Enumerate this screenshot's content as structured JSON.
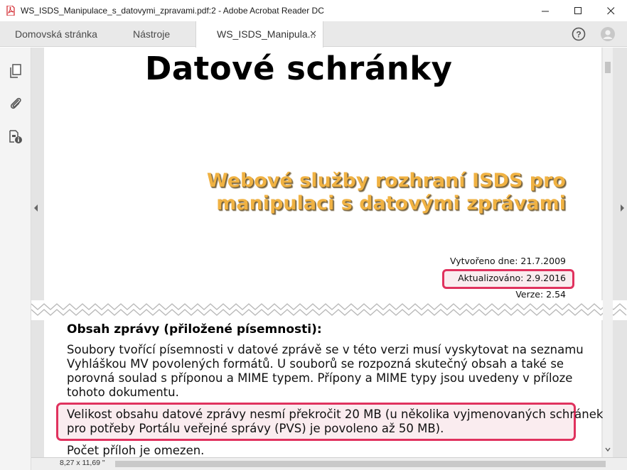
{
  "window": {
    "title": "WS_ISDS_Manipulace_s_datovymi_zpravami.pdf:2 - Adobe Acrobat Reader DC",
    "minimize_label": "—",
    "maximize_label": "☐",
    "close_label": "✕"
  },
  "tabs": [
    {
      "label": "Domovská stránka"
    },
    {
      "label": "Nástroje"
    },
    {
      "label": "WS_ISDS_Manipula...",
      "close": "✕"
    }
  ],
  "document": {
    "title": "Datové schránky",
    "subtitle_line1": "Webové služby rozhraní ISDS pro",
    "subtitle_line2": "manipulaci s datovými zprávami",
    "created": "Vytvořeno dne: 21.7.2009",
    "updated": "Aktualizováno: 2.9.2016",
    "version": "Verze: 2.54",
    "section_heading": "Obsah zprávy (přiložené písemnosti):",
    "paragraph1": "Soubory tvořící písemnosti v datové zprávě se v této verzi musí vyskytovat na seznamu Vyhláškou MV povolených formátů. U souborů se rozpozná skutečný obsah a také se porovná soulad s příponou a MIME typem. Přípony a MIME typy jsou uvedeny v příloze tohoto dokumentu.",
    "paragraph2": "Velikost obsahu datové zprávy nesmí překročit 20 MB (u několika vyjmenovaných schránek pro potřeby Portálu veřejné správy (PVS) je povoleno až 50 MB).",
    "paragraph3": "Počet příloh je omezen."
  },
  "status": {
    "page_size": "8,27 x 11,69 \""
  },
  "colors": {
    "highlight": "#e0325e",
    "subtitle": "#f0b243"
  }
}
